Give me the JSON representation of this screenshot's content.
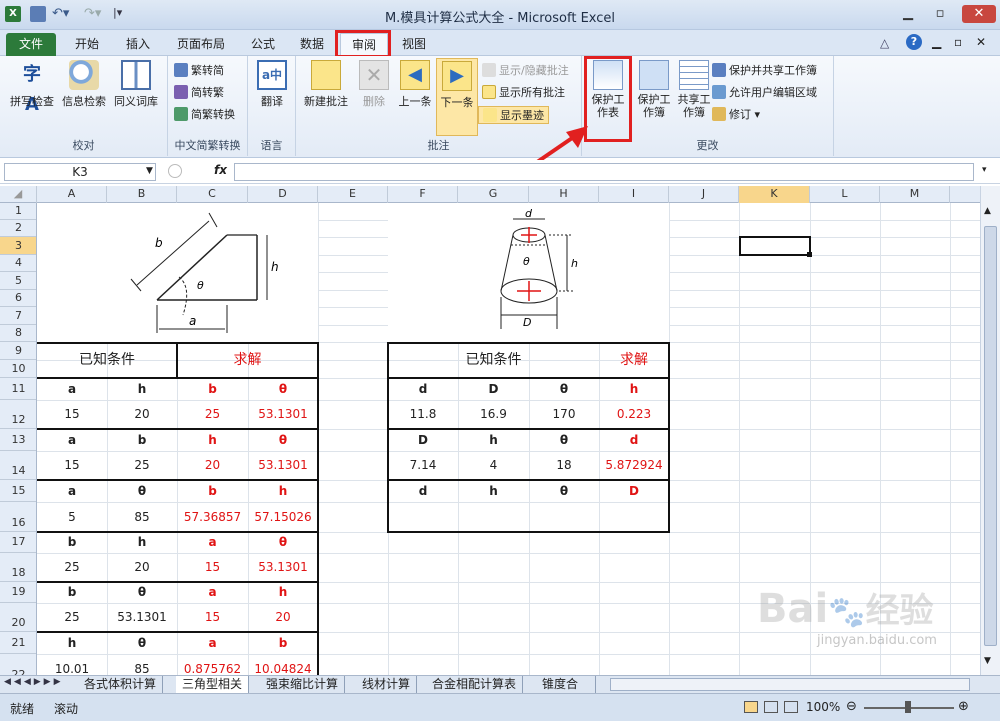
{
  "window": {
    "title": "M.模具计算公式大全 - Microsoft Excel"
  },
  "tabs": [
    {
      "label": "文件"
    },
    {
      "label": "开始"
    },
    {
      "label": "插入"
    },
    {
      "label": "页面布局"
    },
    {
      "label": "公式"
    },
    {
      "label": "数据"
    },
    {
      "label": "审阅"
    },
    {
      "label": "视图"
    }
  ],
  "ribbon": {
    "proofing": {
      "label": "校对",
      "spell": "拼写检查",
      "research": "信息检索",
      "thesaurus": "同义词库"
    },
    "chinese": {
      "label": "中文简繁转换",
      "t2s": "繁转简",
      "s2t": "简转繁",
      "convert": "简繁转换"
    },
    "language": {
      "label": "语言",
      "translate": "翻译"
    },
    "comments": {
      "label": "批注",
      "new": "新建批注",
      "delete": "删除",
      "prev": "上一条",
      "next": "下一条",
      "showhide": "显示/隐藏批注",
      "showall": "显示所有批注",
      "ink": "显示墨迹"
    },
    "changes": {
      "label": "更改",
      "protect_sheet": "保护工作表",
      "protect_book": "保护工作簿",
      "share_book": "共享工作簿",
      "protect_share": "保护并共享工作簿",
      "allow_edit": "允许用户编辑区域",
      "track": "修订"
    }
  },
  "formula_bar": {
    "name_box": "K3",
    "fx": "fx",
    "value": ""
  },
  "columns": [
    "A",
    "B",
    "C",
    "D",
    "E",
    "F",
    "G",
    "H",
    "I",
    "J",
    "K",
    "L",
    "M"
  ],
  "rows": [
    "1",
    "2",
    "3",
    "4",
    "5",
    "6",
    "7",
    "8",
    "9",
    "10",
    "11",
    "12",
    "13",
    "14",
    "15",
    "16",
    "17",
    "18",
    "19",
    "20",
    "21",
    "22"
  ],
  "diagram_labels": {
    "b": "b",
    "h": "h",
    "a": "a",
    "theta": "θ",
    "d": "d",
    "D": "D"
  },
  "left_table": {
    "known": "已知条件",
    "solve": "求解",
    "blocks": [
      {
        "h": [
          "a",
          "h",
          "b",
          "θ"
        ],
        "v": [
          "15",
          "20",
          "25",
          "53.1301"
        ]
      },
      {
        "h": [
          "a",
          "b",
          "h",
          "θ"
        ],
        "v": [
          "15",
          "25",
          "20",
          "53.1301"
        ]
      },
      {
        "h": [
          "a",
          "θ",
          "b",
          "h"
        ],
        "v": [
          "5",
          "85",
          "57.36857",
          "57.15026"
        ]
      },
      {
        "h": [
          "b",
          "h",
          "a",
          "θ"
        ],
        "v": [
          "25",
          "20",
          "15",
          "53.1301"
        ]
      },
      {
        "h": [
          "b",
          "θ",
          "a",
          "h"
        ],
        "v": [
          "25",
          "53.1301",
          "15",
          "20"
        ]
      },
      {
        "h": [
          "h",
          "θ",
          "a",
          "b"
        ],
        "v": [
          "10.01",
          "85",
          "0.875762",
          "10.04824"
        ]
      }
    ]
  },
  "right_table": {
    "known": "已知条件",
    "solve": "求解",
    "blocks": [
      {
        "h": [
          "d",
          "D",
          "θ",
          "h"
        ],
        "v": [
          "11.8",
          "16.9",
          "170",
          "0.223"
        ]
      },
      {
        "h": [
          "D",
          "h",
          "θ",
          "d"
        ],
        "v": [
          "7.14",
          "4",
          "18",
          "5.872924"
        ]
      },
      {
        "h": [
          "d",
          "h",
          "θ",
          "D"
        ],
        "v": [
          "",
          "",
          "",
          ""
        ]
      }
    ]
  },
  "sheets": [
    "各式体积计算",
    "三角型相关",
    "强束缩比计算",
    "线材计算",
    "合金相配计算表",
    "锥度合"
  ],
  "status": {
    "ready": "就绪",
    "scroll": "滚动",
    "zoom": "100%"
  },
  "watermark": {
    "brand": "Bai",
    "brand2": "经验",
    "url": "jingyan.baidu.com"
  },
  "colors": {
    "ribbon_file": "#2c7a3a",
    "highlight": "#e12020",
    "solve_text": "#e01414",
    "selected_header": "#f8d68c"
  }
}
